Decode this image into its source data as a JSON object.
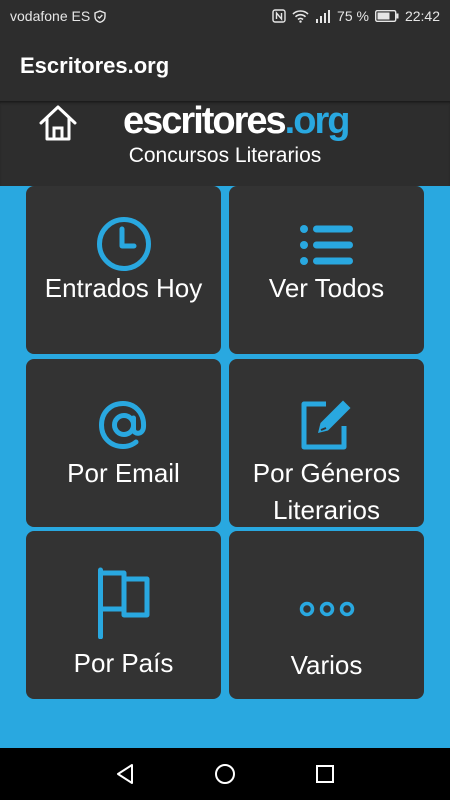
{
  "status_bar": {
    "carrier": "vodafone ES",
    "battery_percent": "75 %",
    "time": "22:42",
    "icons": [
      "shield-icon",
      "nfc-icon",
      "wifi-icon",
      "signal-icon",
      "battery-icon"
    ]
  },
  "app_bar": {
    "title": "Escritores.org"
  },
  "header": {
    "logo_main": "escritores",
    "logo_org": ".org",
    "subtitle": "Concursos Literarios",
    "home_icon": "home-icon"
  },
  "tiles": [
    {
      "label": "Entrados Hoy",
      "icon": "clock-icon"
    },
    {
      "label": "Ver Todos",
      "icon": "list-icon"
    },
    {
      "label": "Por Email",
      "icon": "at-icon"
    },
    {
      "label": "Por Géneros Literarios",
      "icon": "edit-icon"
    },
    {
      "label": "Por País",
      "icon": "flag-icon"
    },
    {
      "label": "Varios",
      "icon": "more-icon"
    }
  ],
  "nav_bar": {
    "icons": [
      "back-icon",
      "home-circle-icon",
      "recents-icon"
    ]
  },
  "colors": {
    "accent": "#29a8e0",
    "dark": "#2d2d2d",
    "tile": "#333333"
  }
}
